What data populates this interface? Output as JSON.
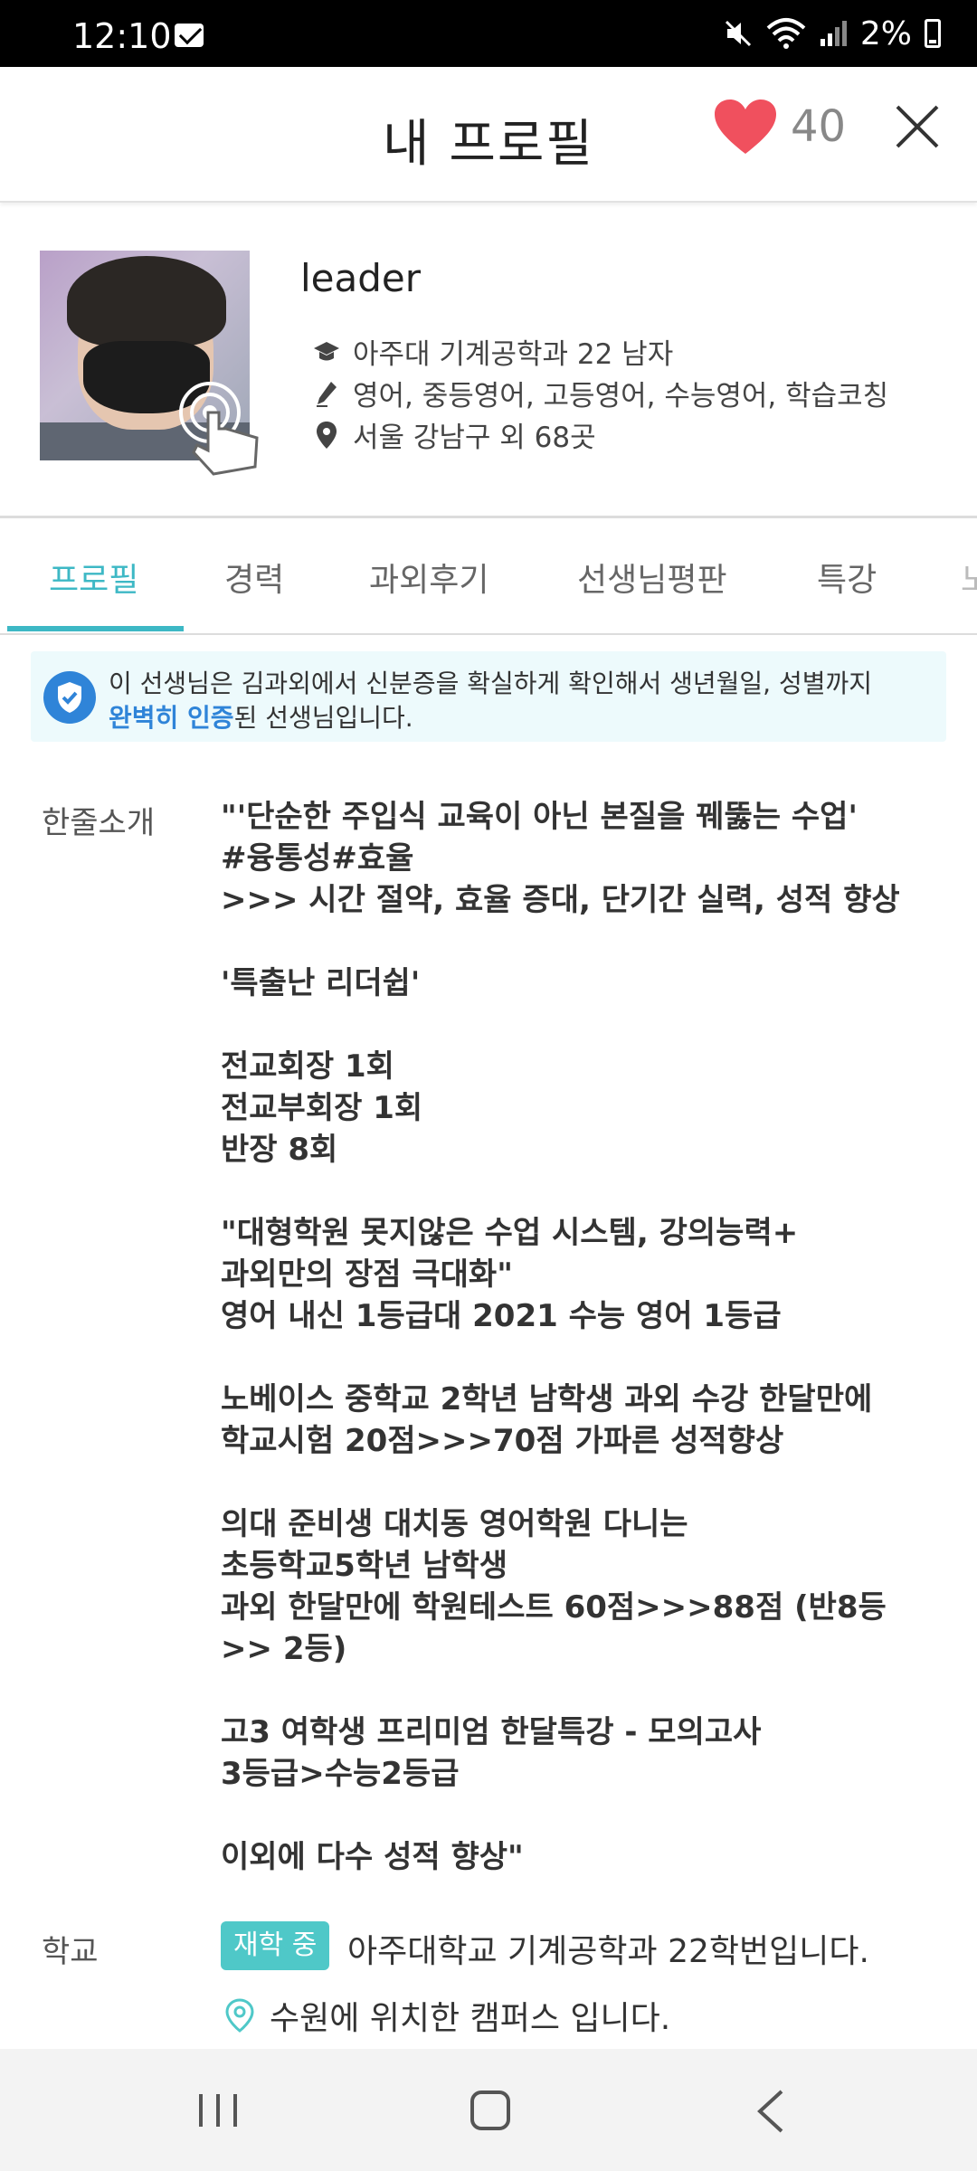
{
  "status_bar": {
    "time": "12:10",
    "battery": "2%"
  },
  "header": {
    "title": "내 프로필",
    "like_count": "40"
  },
  "profile": {
    "name": "leader",
    "education": "아주대 기계공학과 22 남자",
    "subjects": "영어, 중등영어, 고등영어, 수능영어, 학습코칭",
    "location": "서울 강남구 외 68곳"
  },
  "tabs": [
    {
      "label": "프로필"
    },
    {
      "label": "경력"
    },
    {
      "label": "과외후기"
    },
    {
      "label": "선생님평판"
    },
    {
      "label": "특강"
    },
    {
      "label": "노"
    }
  ],
  "verify": {
    "line1": "이 선생님은 김과외에서 신분증을 확실하게 확인해서 생년월일, 성별까지",
    "highlight": "완벽히 인증",
    "line2_rest": "된 선생님입니다."
  },
  "intro": {
    "label": "한줄소개",
    "paragraphs": [
      "\"'단순한 주입식 교육이 아닌 본질을 꿰뚫는 수업'\n#융통성#효율\n>>> 시간 절약, 효율 증대, 단기간 실력, 성적 향상",
      "'특출난 리더쉽'",
      "전교회장 1회\n전교부회장 1회\n반장 8회",
      "\"대형학원 못지않은 수업 시스템, 강의능력+\n과외만의 장점 극대화\"\n영어 내신 1등급대 2021 수능 영어 1등급",
      "노베이스 중학교 2학년 남학생 과외 수강 한달만에\n학교시험 20점>>>70점 가파른 성적향상",
      "의대 준비생 대치동 영어학원 다니는\n초등학교5학년 남학생\n과외 한달만에 학원테스트 60점>>>88점 (반8등\n>> 2등)",
      "고3 여학생 프리미엄 한달특강 - 모의고사\n3등급>수능2등급",
      "이외에 다수 성적 향상\""
    ]
  },
  "school": {
    "label": "학교",
    "badge": "재학 중",
    "text": "아주대학교 기계공학과 22학번입니다.",
    "campus": "수원에 위치한 캠퍼스 입니다."
  },
  "colors": {
    "accent": "#3db8c5",
    "heart": "#f0505e",
    "verify_blue": "#2f84d8",
    "badge": "#4fc8c8"
  },
  "icons": [
    "mail-icon",
    "mute-icon",
    "wifi-icon",
    "signal-icon",
    "battery-icon",
    "heart-icon",
    "close-icon",
    "touch-icon",
    "graduation-cap-icon",
    "pen-icon",
    "location-pin-icon",
    "shield-check-icon",
    "campus-pin-icon",
    "recent-apps-icon",
    "home-icon",
    "back-icon"
  ]
}
